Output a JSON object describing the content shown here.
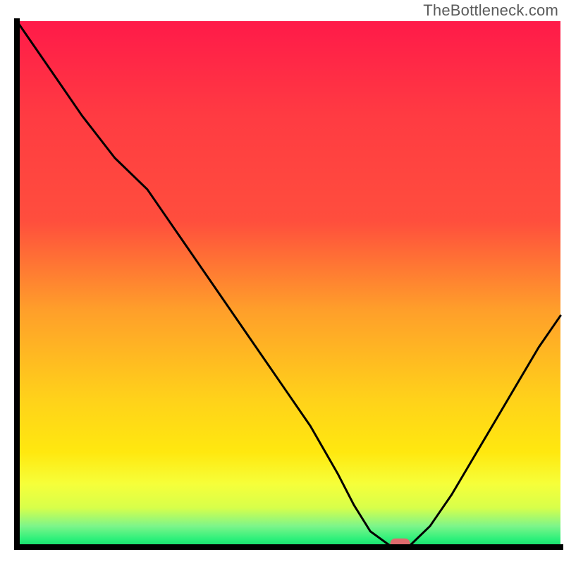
{
  "watermark": "TheBottleneck.com",
  "colors": {
    "gradient_top": "#ff1a49",
    "gradient_mid_red": "#ff4e3d",
    "gradient_orange": "#ff9f2a",
    "gradient_yellow": "#ffe80f",
    "gradient_green_pale": "#d8ff4a",
    "gradient_green": "#2cf07a",
    "gradient_green_deep": "#12d86a",
    "line": "#000000",
    "marker_fill": "#df6a6d",
    "marker_stroke": "#7d2a2d",
    "axis": "#000000"
  },
  "chart_data": {
    "type": "line",
    "title": "",
    "xlabel": "",
    "ylabel": "",
    "xlim": [
      0,
      100
    ],
    "ylim": [
      0,
      100
    ],
    "x": [
      0,
      6,
      12,
      18,
      24,
      30,
      36,
      42,
      48,
      54,
      59,
      62,
      65,
      69,
      72,
      76,
      80,
      84,
      88,
      92,
      96,
      100
    ],
    "y": [
      100,
      91,
      82,
      74,
      68,
      59,
      50,
      41,
      32,
      23,
      14,
      8,
      3,
      0,
      0,
      4,
      10,
      17,
      24,
      31,
      38,
      44
    ],
    "marker": {
      "x": 70.5,
      "y": 0.7
    },
    "annotations": []
  }
}
